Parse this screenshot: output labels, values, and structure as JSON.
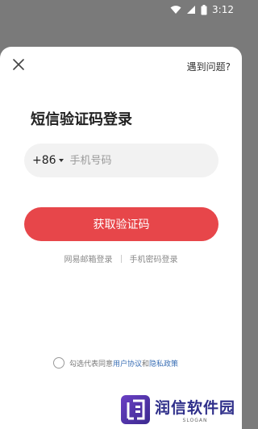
{
  "status_bar": {
    "time": "3:12",
    "icons": [
      "wifi-icon",
      "signal-icon",
      "battery-icon"
    ]
  },
  "header": {
    "close_icon": "close-icon",
    "help_label": "遇到问题?"
  },
  "title": "短信验证码登录",
  "phone": {
    "country_code": "+86",
    "placeholder": "手机号码",
    "value": ""
  },
  "primary_button": "获取验证码",
  "alt_login": {
    "email_label": "网易邮箱登录",
    "password_label": "手机密码登录"
  },
  "agreement": {
    "prefix": "勾选代表同意",
    "user_agreement": "用户协议",
    "and": "和",
    "privacy_policy": "隐私政策"
  },
  "watermark": {
    "title": "润信软件园",
    "slogan": "SLOGAN"
  },
  "colors": {
    "accent": "#e7464a",
    "link": "#3a6fb5",
    "overlay": "#7a7a7a"
  }
}
